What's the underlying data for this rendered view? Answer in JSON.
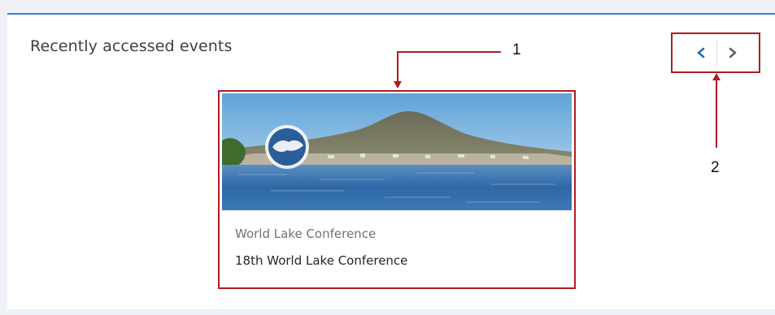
{
  "widget": {
    "title": "Recently accessed events"
  },
  "navigation": {
    "prev_icon": "chevron-left-icon",
    "next_icon": "chevron-right-icon",
    "prev_color": "#1f6fb8",
    "next_color": "#5b6168"
  },
  "event_card": {
    "category": "World Lake Conference",
    "name": "18th World Lake Conference",
    "image_icon": "lake-landscape-image"
  },
  "annotations": [
    {
      "label": "1"
    },
    {
      "label": "2"
    }
  ],
  "colors": {
    "highlight": "#b01c22",
    "panel_border": "#3b82c4"
  }
}
